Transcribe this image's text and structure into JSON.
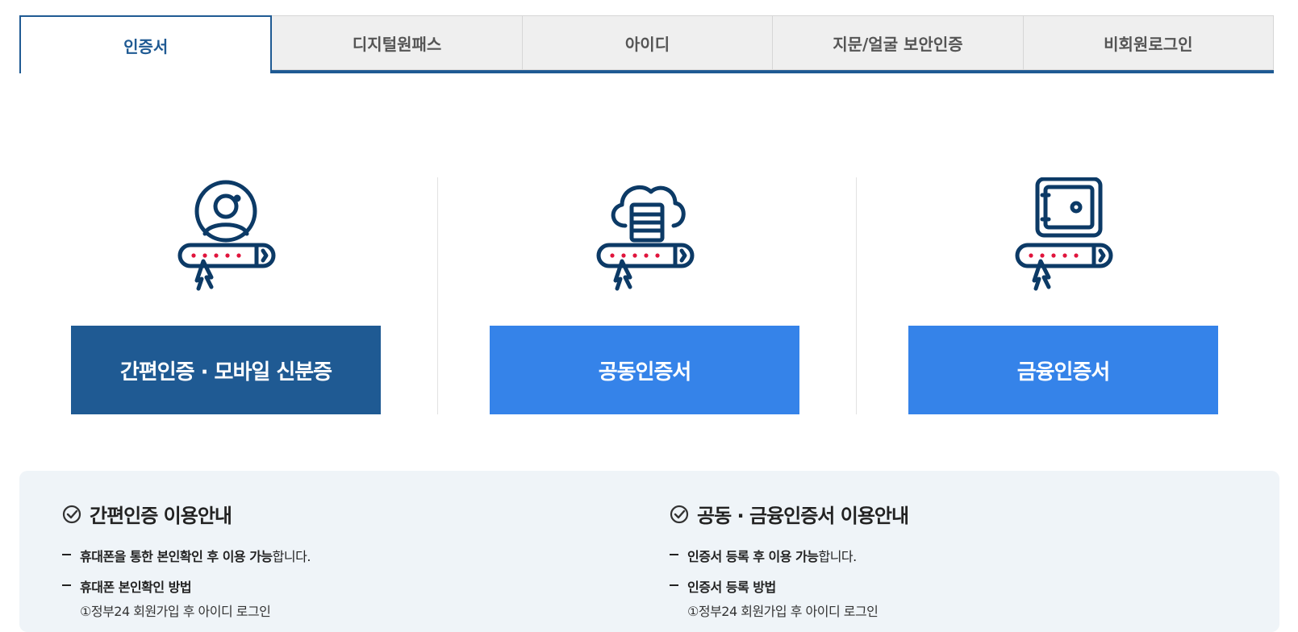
{
  "tabs": [
    {
      "label": "인증서",
      "active": true
    },
    {
      "label": "디지털원패스",
      "active": false
    },
    {
      "label": "아이디",
      "active": false
    },
    {
      "label": "지문/얼굴 보안인증",
      "active": false
    },
    {
      "label": "비회원로그인",
      "active": false
    }
  ],
  "auth_options": [
    {
      "label": "간편인증 · 모바일 신분증",
      "icon": "user-profile-password-icon",
      "color": "#1f5a93"
    },
    {
      "label": "공동인증서",
      "icon": "cloud-server-password-icon",
      "color": "#3583e9"
    },
    {
      "label": "금융인증서",
      "icon": "safe-password-icon",
      "color": "#3583e9"
    }
  ],
  "guide": {
    "simple": {
      "title": "간편인증 이용안내",
      "line1_bold": "휴대폰을 통한 본인확인 후 이용 가능",
      "line1_rest": "합니다.",
      "line2_bold": "휴대폰 본인확인 방법",
      "line2_step": "①정부24 회원가입 후 아이디 로그인"
    },
    "cert": {
      "title": "공동 · 금융인증서 이용안내",
      "line1_bold": "인증서 등록 후 이용 가능",
      "line1_rest": "합니다.",
      "line2_bold": "인증서 등록 방법",
      "line2_step": "①정부24 회원가입 후 아이디 로그인"
    }
  },
  "colors": {
    "primary_dark": "#1f5a93",
    "primary": "#3583e9",
    "guide_bg": "#eff4f8",
    "password_dot": "#e0143c"
  }
}
